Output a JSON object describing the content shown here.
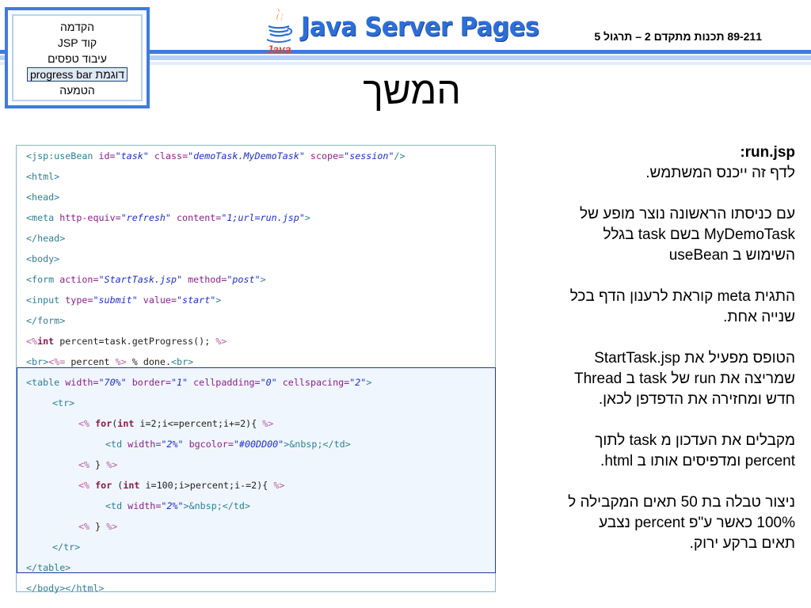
{
  "nav": {
    "items": [
      {
        "label": "הקדמה",
        "active": false
      },
      {
        "label": "קוד JSP",
        "active": false
      },
      {
        "label": "עיבוד טפסים",
        "active": false
      },
      {
        "label": "דוגמת progress bar",
        "active": true
      },
      {
        "label": "הטמעה",
        "active": false
      }
    ]
  },
  "header": {
    "logo_text": "Java",
    "product_title": "Java Server Pages",
    "course_title": "89-211 תכנות מתקדם 2 – תרגול 5"
  },
  "slide": {
    "heading": "המשך"
  },
  "code": {
    "lines": [
      {
        "indent": 0,
        "tokens": [
          {
            "t": "<jsp:useBean ",
            "c": "tag"
          },
          {
            "t": "id=",
            "c": "attr"
          },
          {
            "t": "\"task\"",
            "c": "val"
          },
          {
            "t": " class=",
            "c": "attr"
          },
          {
            "t": "\"demoTask.MyDemoTask\"",
            "c": "val"
          },
          {
            "t": " scope=",
            "c": "attr"
          },
          {
            "t": "\"session\"",
            "c": "val"
          },
          {
            "t": "/>",
            "c": "tag"
          }
        ]
      },
      {
        "indent": 0,
        "tokens": [
          {
            "t": "<html>",
            "c": "tag"
          }
        ]
      },
      {
        "indent": 0,
        "tokens": [
          {
            "t": "<head>",
            "c": "tag"
          }
        ]
      },
      {
        "indent": 0,
        "tokens": [
          {
            "t": "<meta ",
            "c": "tag"
          },
          {
            "t": "http-equiv=",
            "c": "attr"
          },
          {
            "t": "\"refresh\"",
            "c": "val"
          },
          {
            "t": " content=",
            "c": "attr"
          },
          {
            "t": "\"1;url=run.jsp\"",
            "c": "val"
          },
          {
            "t": ">",
            "c": "tag"
          }
        ]
      },
      {
        "indent": 0,
        "tokens": [
          {
            "t": "</head>",
            "c": "tag"
          }
        ]
      },
      {
        "indent": 0,
        "tokens": [
          {
            "t": "<body>",
            "c": "tag"
          }
        ]
      },
      {
        "indent": 0,
        "tokens": [
          {
            "t": "<form ",
            "c": "tag"
          },
          {
            "t": "action=",
            "c": "attr"
          },
          {
            "t": "\"StartTask.jsp\"",
            "c": "val"
          },
          {
            "t": " method=",
            "c": "attr"
          },
          {
            "t": "\"post\"",
            "c": "val"
          },
          {
            "t": ">",
            "c": "tag"
          }
        ]
      },
      {
        "indent": 0,
        "tokens": [
          {
            "t": "<input ",
            "c": "tag"
          },
          {
            "t": "type=",
            "c": "attr"
          },
          {
            "t": "\"submit\"",
            "c": "val"
          },
          {
            "t": " value=",
            "c": "attr"
          },
          {
            "t": "\"start\"",
            "c": "val"
          },
          {
            "t": ">",
            "c": "tag"
          }
        ]
      },
      {
        "indent": 0,
        "tokens": [
          {
            "t": "</form>",
            "c": "tag"
          }
        ]
      },
      {
        "indent": 0,
        "tokens": [
          {
            "t": "<%",
            "c": "op"
          },
          {
            "t": "int",
            "c": "kw"
          },
          {
            "t": " percent=task.getProgress(); ",
            "c": "txt"
          },
          {
            "t": "%>",
            "c": "op"
          }
        ]
      },
      {
        "indent": 0,
        "tokens": [
          {
            "t": "<br>",
            "c": "tag"
          },
          {
            "t": "<%=",
            "c": "op"
          },
          {
            "t": " percent ",
            "c": "txt"
          },
          {
            "t": "%>",
            "c": "op"
          },
          {
            "t": " % done.",
            "c": "txt"
          },
          {
            "t": "<br>",
            "c": "tag"
          }
        ]
      },
      {
        "indent": 0,
        "tokens": [
          {
            "t": "<table ",
            "c": "tag"
          },
          {
            "t": "width=",
            "c": "attr"
          },
          {
            "t": "\"70%\"",
            "c": "val"
          },
          {
            "t": " border=",
            "c": "attr"
          },
          {
            "t": "\"1\"",
            "c": "val"
          },
          {
            "t": " cellpadding=",
            "c": "attr"
          },
          {
            "t": "\"0\"",
            "c": "val"
          },
          {
            "t": " cellspacing=",
            "c": "attr"
          },
          {
            "t": "\"2\"",
            "c": "val"
          },
          {
            "t": ">",
            "c": "tag"
          }
        ]
      },
      {
        "indent": 1,
        "tokens": [
          {
            "t": "<tr>",
            "c": "tag"
          }
        ]
      },
      {
        "indent": 2,
        "tokens": [
          {
            "t": "<%",
            "c": "op"
          },
          {
            "t": " ",
            "c": "txt"
          },
          {
            "t": "for",
            "c": "kw"
          },
          {
            "t": "(",
            "c": "txt"
          },
          {
            "t": "int",
            "c": "kw"
          },
          {
            "t": " i=2;i<=percent;i+=2){ ",
            "c": "txt"
          },
          {
            "t": "%>",
            "c": "op"
          }
        ]
      },
      {
        "indent": 3,
        "tokens": [
          {
            "t": "<td ",
            "c": "tag"
          },
          {
            "t": "width=",
            "c": "attr"
          },
          {
            "t": "\"2%\"",
            "c": "val"
          },
          {
            "t": " bgcolor=",
            "c": "attr"
          },
          {
            "t": "\"#00DD00\"",
            "c": "val"
          },
          {
            "t": ">&nbsp;</td>",
            "c": "tag"
          }
        ]
      },
      {
        "indent": 2,
        "tokens": [
          {
            "t": "<%",
            "c": "op"
          },
          {
            "t": " } ",
            "c": "txt"
          },
          {
            "t": "%>",
            "c": "op"
          }
        ]
      },
      {
        "indent": 2,
        "tokens": [
          {
            "t": "<%",
            "c": "op"
          },
          {
            "t": " ",
            "c": "txt"
          },
          {
            "t": "for",
            "c": "kw"
          },
          {
            "t": " (",
            "c": "txt"
          },
          {
            "t": "int",
            "c": "kw"
          },
          {
            "t": " i=100;i>percent;i-=2){ ",
            "c": "txt"
          },
          {
            "t": "%>",
            "c": "op"
          }
        ]
      },
      {
        "indent": 3,
        "tokens": [
          {
            "t": "<td ",
            "c": "tag"
          },
          {
            "t": "width=",
            "c": "attr"
          },
          {
            "t": "\"2%\"",
            "c": "val"
          },
          {
            "t": ">&nbsp;</td>",
            "c": "tag"
          }
        ]
      },
      {
        "indent": 2,
        "tokens": [
          {
            "t": "<%",
            "c": "op"
          },
          {
            "t": " } ",
            "c": "txt"
          },
          {
            "t": "%>",
            "c": "op"
          }
        ]
      },
      {
        "indent": 1,
        "tokens": [
          {
            "t": "</tr>",
            "c": "tag"
          }
        ]
      },
      {
        "indent": 0,
        "tokens": [
          {
            "t": "</table>",
            "c": "tag"
          }
        ]
      },
      {
        "indent": 0,
        "tokens": [
          {
            "t": "</body></html>",
            "c": "tag"
          }
        ]
      }
    ]
  },
  "description": {
    "title": "run.jsp:",
    "paragraphs": [
      [
        "לדף זה ייכנס המשתמש."
      ],
      [
        "עם כניסתו הראשונה נוצר מופע של",
        "MyDemoTask בשם task בגלל",
        "השימוש ב useBean"
      ],
      [
        "התגית meta קוראת לרענון הדף בכל",
        "שנייה אחת."
      ],
      [
        "הטופס מפעיל את StartTask.jsp",
        "שמריצה את run של task ב Thread",
        "חדש ומחזירה את הדפדפן לכאן."
      ],
      [
        "מקבלים את העדכון מ task לתוך",
        "percent ומדפיסים אותו ב html."
      ],
      [
        "ניצור טבלה בת 50 תאים המקבילה ל",
        "100% כאשר ע\"פ percent נצבע",
        "תאים ברקע ירוק."
      ]
    ]
  },
  "colors": {
    "accent": "#3d7be0",
    "code_tag": "#2e7f93",
    "code_attr": "#8b1f8b",
    "code_value": "#1d2fc8",
    "code_keyword": "#8b1a4c",
    "code_scriptlet": "#b55ba6"
  }
}
